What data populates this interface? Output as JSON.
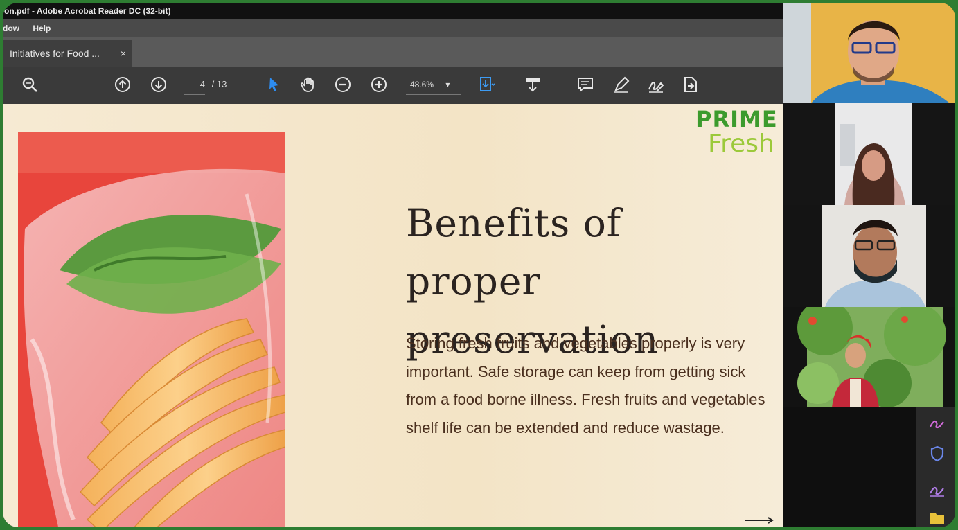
{
  "window": {
    "title": "on.pdf - Adobe Acrobat Reader DC (32-bit)"
  },
  "menu": [
    "dow",
    "Help"
  ],
  "tab": {
    "label": "Initiatives for Food ...",
    "close": "×"
  },
  "toolbar": {
    "page_current": "4",
    "page_total": "/ 13",
    "zoom": "48.6%",
    "zoom_caret": "▾",
    "icons": [
      "search-icon",
      "page-up-icon",
      "page-down-icon",
      "select-arrow-icon",
      "hand-icon",
      "zoom-out-icon",
      "zoom-in-icon",
      "page-fit-icon",
      "scroll-mode-icon",
      "comment-icon",
      "highlight-pen-icon",
      "sign-icon",
      "share-icon"
    ]
  },
  "slide": {
    "title": "Benefits of proper preservation",
    "body": "Storing fresh fruits and vegetables properly is very important. Safe storage can keep from getting sick from a food borne illness. Fresh fruits and vegetables shelf life can be extended and reduce wastage.",
    "logo_line1": "PRIME",
    "logo_line2": "Fresh"
  },
  "colors": {
    "frame": "#2e7d32",
    "photo_bg": "#e8453c",
    "title_text": "#2a2320",
    "body_text": "#4a2f1e",
    "logo_green": "#3c9b2d",
    "logo_lime": "#9cc93a"
  },
  "participants": [
    {
      "kind": "man-glasses-yellow-wall"
    },
    {
      "kind": "woman-long-hair"
    },
    {
      "kind": "man-glasses-mask"
    },
    {
      "kind": "man-turban-outdoors"
    }
  ],
  "side_panel_icons": [
    "annotate-pen-icon",
    "shield-icon",
    "signature-icon",
    "folder-icon"
  ]
}
